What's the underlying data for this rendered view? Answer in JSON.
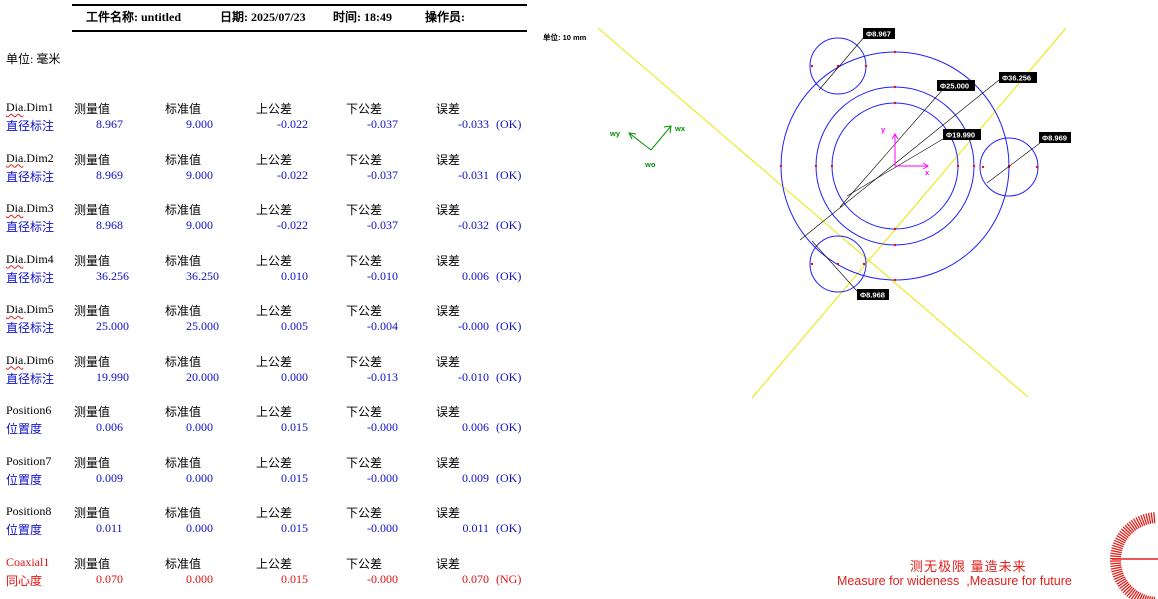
{
  "header": {
    "part_label": "工件名称: untitled",
    "date_label": "日期: 2025/07/23",
    "time_label": "时间: 18:49",
    "operator_label": "操作员:"
  },
  "unit_label": "单位: 毫米",
  "columns": {
    "measured": "测量值",
    "nominal": "标准值",
    "upper": "上公差",
    "lower": "下公差",
    "error": "误差"
  },
  "rows": [
    {
      "name": "Dia.Dim1",
      "type": "直径标注",
      "measured": "8.967",
      "nominal": "9.000",
      "upper": "-0.022",
      "lower": "-0.037",
      "error": "-0.033",
      "status": "(OK)"
    },
    {
      "name": "Dia.Dim2",
      "type": "直径标注",
      "measured": "8.969",
      "nominal": "9.000",
      "upper": "-0.022",
      "lower": "-0.037",
      "error": "-0.031",
      "status": "(OK)"
    },
    {
      "name": "Dia.Dim3",
      "type": "直径标注",
      "measured": "8.968",
      "nominal": "9.000",
      "upper": "-0.022",
      "lower": "-0.037",
      "error": "-0.032",
      "status": "(OK)"
    },
    {
      "name": "Dia.Dim4",
      "type": "直径标注",
      "measured": "36.256",
      "nominal": "36.250",
      "upper": "0.010",
      "lower": "-0.010",
      "error": "0.006",
      "status": "(OK)"
    },
    {
      "name": "Dia.Dim5",
      "type": "直径标注",
      "measured": "25.000",
      "nominal": "25.000",
      "upper": "0.005",
      "lower": "-0.004",
      "error": "-0.000",
      "status": "(OK)"
    },
    {
      "name": "Dia.Dim6",
      "type": "直径标注",
      "measured": "19.990",
      "nominal": "20.000",
      "upper": "0.000",
      "lower": "-0.013",
      "error": "-0.010",
      "status": "(OK)"
    },
    {
      "name": "Position6",
      "type": "位置度",
      "measured": "0.006",
      "nominal": "0.000",
      "upper": "0.015",
      "lower": "-0.000",
      "error": "0.006",
      "status": "(OK)"
    },
    {
      "name": "Position7",
      "type": "位置度",
      "measured": "0.009",
      "nominal": "0.000",
      "upper": "0.015",
      "lower": "-0.000",
      "error": "0.009",
      "status": "(OK)"
    },
    {
      "name": "Position8",
      "type": "位置度",
      "measured": "0.011",
      "nominal": "0.000",
      "upper": "0.015",
      "lower": "-0.000",
      "error": "0.011",
      "status": "(OK)"
    },
    {
      "name": "Coaxial1",
      "type": "同心度",
      "measured": "0.070",
      "nominal": "0.000",
      "upper": "0.015",
      "lower": "-0.000",
      "error": "0.070",
      "status": "(NG)"
    }
  ],
  "drawing": {
    "scale_label": "单位: 10 mm",
    "axis_labels": {
      "wx": "wx",
      "wy": "wy",
      "wo": "wo",
      "x": "x",
      "y": "y"
    },
    "dims": {
      "d1": "Φ8.967",
      "d2": "Φ8.969",
      "d3": "Φ8.968",
      "d4": "Φ36.256",
      "d5": "Φ25.000",
      "d6": "Φ19.990"
    }
  },
  "slogan": {
    "cn": "测无极限  量造未来",
    "en": "Measure for wideness  ,Measure for future"
  },
  "colors": {
    "value_blue": "#1010c8",
    "ng_red": "#e01010",
    "circle_blue": "#2020ff",
    "guide_yellow": "#e8e800",
    "axis_green": "#009000",
    "axis_magenta": "#ff00ff",
    "brand_red": "#e0201c"
  }
}
